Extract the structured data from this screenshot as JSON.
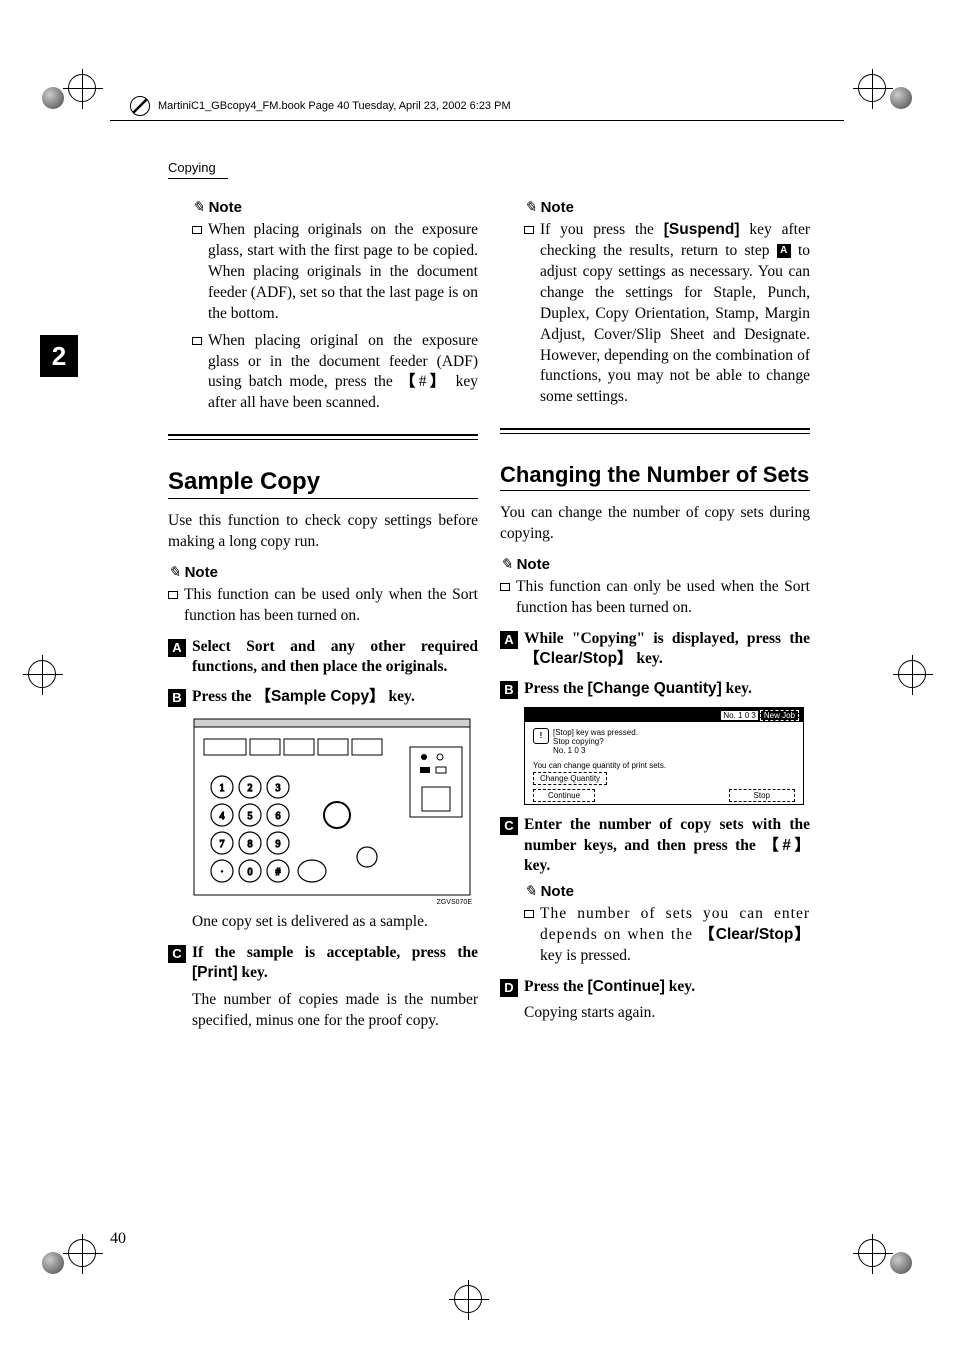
{
  "header": {
    "filepath": "MartiniC1_GBcopy4_FM.book  Page 40  Tuesday, April 23, 2002  6:23 PM"
  },
  "section_label": "Copying",
  "chapter_tab": "2",
  "page_number": "40",
  "left_col": {
    "note1_heading": "Note",
    "note1_b1": "When placing originals on the exposure glass, start with the first page to be copied. When placing originals in the document feeder (ADF), set so that the last page is on the bottom.",
    "note1_b2_pre": "When placing original on the exposure glass or in the document feeder (ADF) using batch mode, press the ",
    "note1_b2_key": "#",
    "note1_b2_post": " key after all have been scanned.",
    "h2": "Sample Copy",
    "intro": "Use this function to check copy settings before making a long copy run.",
    "note2_heading": "Note",
    "note2_b1": "This function can be used only when the Sort function has been turned on.",
    "step1": "Select Sort and any other required functions, and then place the originals.",
    "step2_pre": "Press the ",
    "step2_key": "Sample Copy",
    "step2_post": " key.",
    "img_caption": "ZGVS070E",
    "sample_line": "One copy set is delivered as a sample.",
    "step3_pre": "If the sample is acceptable, press the ",
    "step3_key": "[Print]",
    "step3_post": " key.",
    "step3_body": "The number of copies made is the number specified, minus one for the proof copy."
  },
  "right_col": {
    "note1_heading": "Note",
    "note1_pre": "If you press the ",
    "note1_key": "[Suspend]",
    "note1_mid": " key after checking the results, return to step ",
    "note1_step": "A",
    "note1_post": " to adjust copy settings as necessary. You can change the settings for Staple, Punch, Duplex, Copy Orientation, Stamp, Margin Adjust, Cover/Slip Sheet and Designate. However, depending on the combination of functions, you may not be able to change some settings.",
    "h2": "Changing the Number of Sets",
    "intro": "You can change the number of copy sets during copying.",
    "note2_heading": "Note",
    "note2_b1": "This function can only be used when the Sort function has been turned on.",
    "step1_pre": "While \"Copying\" is displayed, press the ",
    "step1_key": "Clear/Stop",
    "step1_post": " key.",
    "step2_pre": "Press the ",
    "step2_key": "[Change Quantity]",
    "step2_post": " key.",
    "ui_no_label": "No.",
    "ui_no_value": "1 0 3",
    "ui_newjob": "New Job",
    "ui_msg1": "[Stop] key was pressed.",
    "ui_msg2": "Stop copying?",
    "ui_msg3": "No. 1 0 3",
    "ui_msg4": "You can change quantity of print sets.",
    "ui_btn_change": "Change Quantity",
    "ui_btn_continue": "Continue",
    "ui_btn_stop": "Stop",
    "step3_pre": "Enter the number of copy sets with the number keys, and then press the ",
    "step3_key": "#",
    "step3_post": " key.",
    "note3_heading": "Note",
    "note3_pre": "The number of sets you can enter depends on when the ",
    "note3_key": "Clear/Stop",
    "note3_post": " key is pressed.",
    "step4_pre": "Press the ",
    "step4_key": "[Continue]",
    "step4_post": " key.",
    "step4_body": "Copying starts again."
  }
}
